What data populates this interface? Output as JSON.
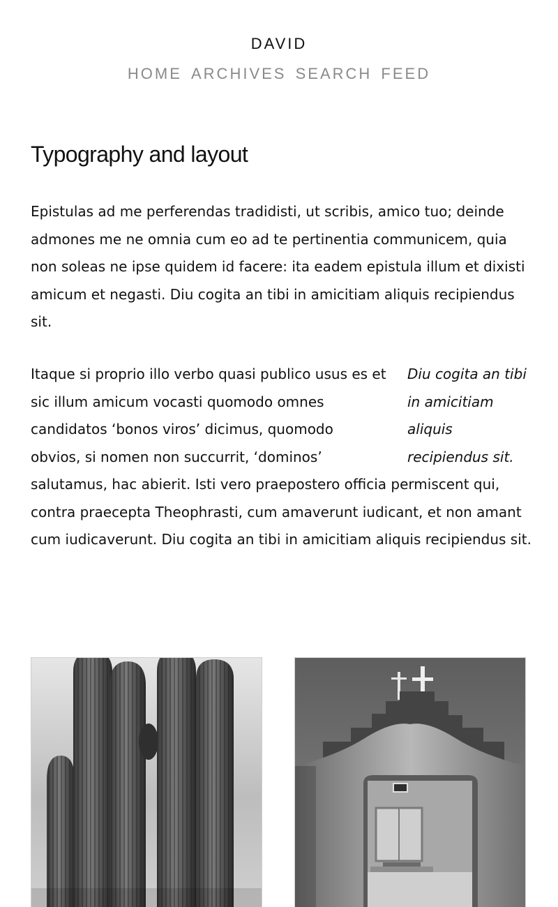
{
  "site": {
    "title": "DAVID"
  },
  "nav": {
    "items": [
      {
        "label": "HOME"
      },
      {
        "label": "ARCHIVES"
      },
      {
        "label": "SEARCH"
      },
      {
        "label": "FEED"
      }
    ]
  },
  "post": {
    "title": "Typography and layout",
    "paragraph1": "Epistulas ad me perferendas tradidisti, ut scribis, amico tuo; deinde admones me ne omnia cum eo ad te pertinentia communicem, quia non soleas ne ipse quidem id facere: ita eadem epistula illum et dixisti amicum et negasti. Diu cogita an tibi in amicitiam aliquis recipiendus sit.",
    "paragraph2": "Itaque si proprio illo verbo quasi publico usus es et sic illum amicum vocasti quomodo omnes candidatos ‘bonos viros’ dicimus, quomodo obvios, si nomen non succurrit, ‘dominos’ salutamus, hac abierit. Isti vero praepostero officia permiscent qui, contra praecepta Theophrasti, cum amaverunt iudicant, et non amant cum iudicaverunt. Diu cogita an tibi in amicitiam aliquis recipiendus sit.",
    "pullquote": "Diu cogita an tibi in amicitiam aliquis recipiendus sit."
  },
  "images": {
    "left": "saguaro cactus photograph",
    "right": "adobe church gateway photograph"
  }
}
